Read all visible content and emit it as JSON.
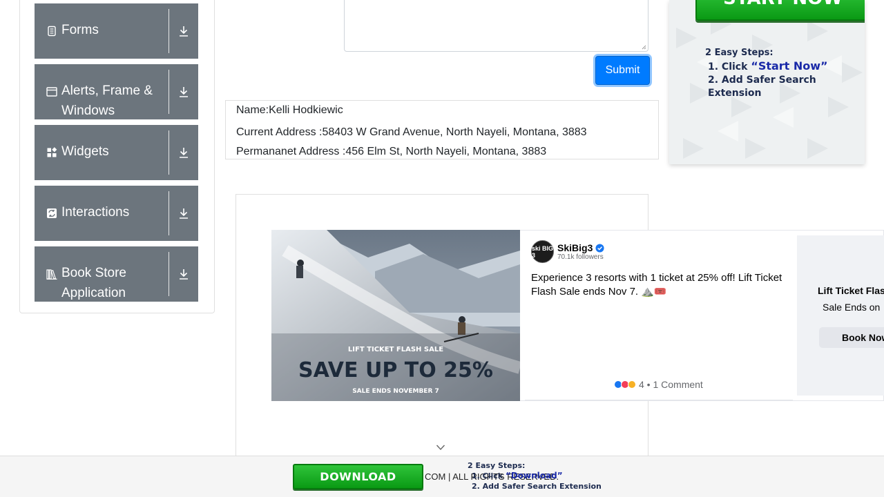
{
  "sidebar": {
    "groups": [
      {
        "label": "Forms",
        "icon": "document-icon"
      },
      {
        "label": "Alerts, Frame & Windows",
        "icon": "window-icon"
      },
      {
        "label": "Widgets",
        "icon": "widgets-icon"
      },
      {
        "label": "Interactions",
        "icon": "interactions-icon"
      },
      {
        "label": "Book Store Application",
        "icon": "books-icon"
      }
    ]
  },
  "form": {
    "submit_label": "Submit"
  },
  "output": {
    "name": "Name:Kelli Hodkiewic",
    "current_address": "Current Address :58403 W Grand Avenue, North Nayeli, Montana, 3883",
    "permanent_address": "Permananet Address :456 Elm St, North Nayeli, Montana, 3883"
  },
  "right_ad": {
    "button_label": "START NOW",
    "steps_title": "2 Easy Steps:",
    "step1_prefix": "1. Click ",
    "step1_emphasis": "“Start Now”",
    "step2": "2. Add Safer Search Extension"
  },
  "fb_ad": {
    "page_name": "SkiBig3",
    "followers": "70.1k followers",
    "logo_text": "ski BIG 3",
    "text": "Experience 3 resorts with 1 ticket at 25% off! Lift Ticket Flash Sale ends Nov 7. ⛰️🎟️",
    "image_line1": "LIFT TICKET FLASH SALE",
    "image_line2": "SAVE UP TO 25%",
    "image_line3": "SALE ENDS NOVEMBER 7",
    "reactions": "4 • 1 Comment",
    "side_headline": "Lift Ticket Flas",
    "side_sub": "Sale Ends on",
    "side_button": "Book Now"
  },
  "footer": {
    "copyright": "COM | ALL RIGHTS RESERVED.",
    "download_label": "DOWNLOAD",
    "steps_title": "2 Easy Steps:",
    "step1_prefix": "1. Click ",
    "step1_emphasis": "“Download”",
    "step2": "2. Add Safer Search Extension"
  },
  "colors": {
    "sidebar_group_bg": "#6c757d",
    "primary": "#007bff",
    "ad_green": "#0a9a14",
    "steps_text": "#1d2b4f"
  }
}
